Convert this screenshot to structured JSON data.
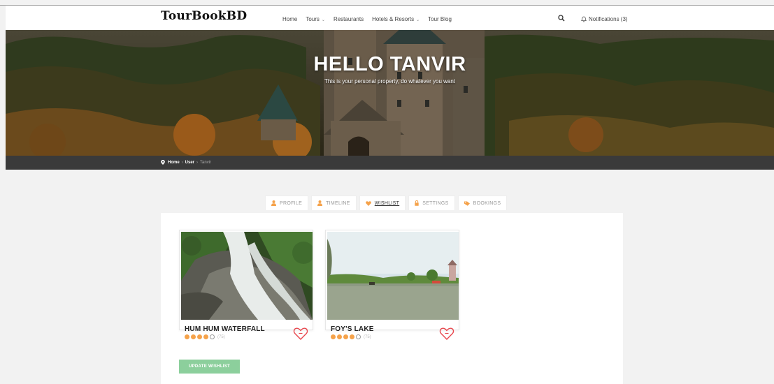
{
  "header": {
    "logo": "TourBookBD",
    "nav": [
      {
        "label": "Home",
        "caret": false
      },
      {
        "label": "Tours",
        "caret": true
      },
      {
        "label": "Restaurants",
        "caret": false
      },
      {
        "label": "Hotels & Resorts",
        "caret": true
      },
      {
        "label": "Tour Blog",
        "caret": false
      }
    ],
    "notifications_label": "Notifications (3)"
  },
  "hero": {
    "title": "HELLO TANVIR",
    "subtitle": "This is your personal property, do whatever you want"
  },
  "breadcrumb": {
    "items": [
      "Home",
      "User",
      "Tanvir"
    ]
  },
  "tabs": [
    {
      "label": "PROFILE",
      "icon": "user-icon",
      "active": false
    },
    {
      "label": "TIMELINE",
      "icon": "user-icon",
      "active": false
    },
    {
      "label": "WISHLIST",
      "icon": "heart-icon",
      "active": true
    },
    {
      "label": "SETTINGS",
      "icon": "lock-icon",
      "active": false
    },
    {
      "label": "BOOKINGS",
      "icon": "tag-icon",
      "active": false
    }
  ],
  "wishlist": [
    {
      "title": "HUM HUM WATERFALL",
      "rating": 4,
      "max_rating": 5,
      "reviews": "(75)"
    },
    {
      "title": "FOY'S LAKE",
      "rating": 4,
      "max_rating": 5,
      "reviews": "(75)"
    }
  ],
  "update_button": "UPDATE WISHLIST",
  "colors": {
    "accent": "#f5a24a",
    "heart": "#e8474e",
    "button": "#8ccf9c",
    "crumbbar": "#3a3a3a"
  }
}
